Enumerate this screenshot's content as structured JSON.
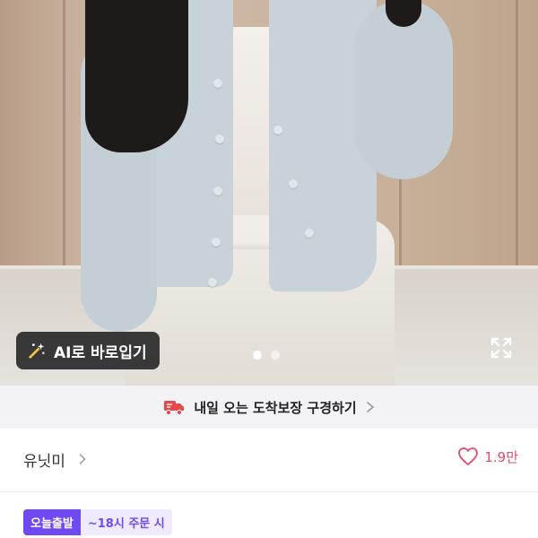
{
  "product_image": {
    "ai_tryon_label": "AI로 바로입기",
    "carousel_total": 2,
    "carousel_active": 1
  },
  "delivery_banner": {
    "text": "내일 오는 도착보장 구경하기"
  },
  "brand": {
    "name": "유닛미",
    "like_count": "1.9만"
  },
  "tags": {
    "primary": "오늘출발",
    "secondary": "~18시 주문 시"
  },
  "colors": {
    "accent": "#6f4af0",
    "like": "#e24a6a"
  }
}
